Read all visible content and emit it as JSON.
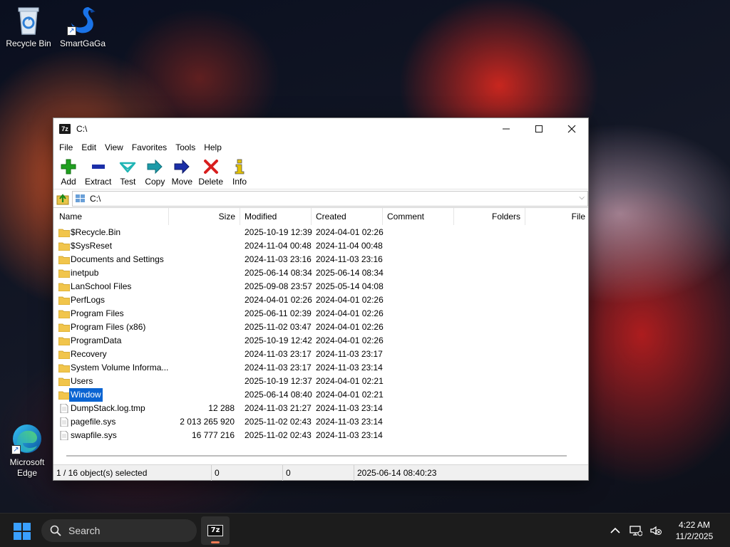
{
  "desktop": {
    "icons": [
      {
        "label": "Recycle Bin"
      },
      {
        "label": "SmartGaGa"
      },
      {
        "label": "Microsoft Edge"
      }
    ]
  },
  "window": {
    "title": "C:\\",
    "app_icon_text": "7z",
    "controls": {
      "minimize": "—",
      "maximize": "☐",
      "close": "✕"
    },
    "menu": [
      "File",
      "Edit",
      "View",
      "Favorites",
      "Tools",
      "Help"
    ],
    "toolbar": [
      {
        "label": "Add",
        "icon": "plus-icon",
        "color": "#1fa01f"
      },
      {
        "label": "Extract",
        "icon": "minus-icon",
        "color": "#1b2fa8"
      },
      {
        "label": "Test",
        "icon": "check-icon",
        "color": "#1fb5b5"
      },
      {
        "label": "Copy",
        "icon": "copy-arrow-icon",
        "color": "#1c9aa8"
      },
      {
        "label": "Move",
        "icon": "move-arrow-icon",
        "color": "#1b2fa8"
      },
      {
        "label": "Delete",
        "icon": "delete-x-icon",
        "color": "#d81e1e"
      },
      {
        "label": "Info",
        "icon": "info-icon",
        "color": "#c9a800"
      }
    ],
    "address": "C:\\",
    "columns": [
      "Name",
      "Size",
      "Modified",
      "Created",
      "Comment",
      "Folders",
      "File"
    ],
    "files": [
      {
        "name": "$Recycle.Bin",
        "size": "",
        "modified": "2025-10-19 12:39",
        "created": "2024-04-01 02:26",
        "type": "folder"
      },
      {
        "name": "$SysReset",
        "size": "",
        "modified": "2024-11-04 00:48",
        "created": "2024-11-04 00:48",
        "type": "folder"
      },
      {
        "name": "Documents and Settings",
        "size": "",
        "modified": "2024-11-03 23:16",
        "created": "2024-11-03 23:16",
        "type": "folder"
      },
      {
        "name": "inetpub",
        "size": "",
        "modified": "2025-06-14 08:34",
        "created": "2025-06-14 08:34",
        "type": "folder"
      },
      {
        "name": "LanSchool Files",
        "size": "",
        "modified": "2025-09-08 23:57",
        "created": "2025-05-14 04:08",
        "type": "folder"
      },
      {
        "name": "PerfLogs",
        "size": "",
        "modified": "2024-04-01 02:26",
        "created": "2024-04-01 02:26",
        "type": "folder"
      },
      {
        "name": "Program Files",
        "size": "",
        "modified": "2025-06-11 02:39",
        "created": "2024-04-01 02:26",
        "type": "folder"
      },
      {
        "name": "Program Files (x86)",
        "size": "",
        "modified": "2025-11-02 03:47",
        "created": "2024-04-01 02:26",
        "type": "folder"
      },
      {
        "name": "ProgramData",
        "size": "",
        "modified": "2025-10-19 12:42",
        "created": "2024-04-01 02:26",
        "type": "folder"
      },
      {
        "name": "Recovery",
        "size": "",
        "modified": "2024-11-03 23:17",
        "created": "2024-11-03 23:17",
        "type": "folder"
      },
      {
        "name": "System Volume Informa...",
        "size": "",
        "modified": "2024-11-03 23:17",
        "created": "2024-11-03 23:14",
        "type": "folder"
      },
      {
        "name": "Users",
        "size": "",
        "modified": "2025-10-19 12:37",
        "created": "2024-04-01 02:21",
        "type": "folder"
      },
      {
        "name": "Window",
        "size": "",
        "modified": "2025-06-14 08:40",
        "created": "2024-04-01 02:21",
        "type": "folder",
        "selected": true
      },
      {
        "name": "DumpStack.log.tmp",
        "size": "12 288",
        "modified": "2024-11-03 21:27",
        "created": "2024-11-03 23:14",
        "type": "file"
      },
      {
        "name": "pagefile.sys",
        "size": "2 013 265 920",
        "modified": "2025-11-02 02:43",
        "created": "2024-11-03 23:14",
        "type": "file"
      },
      {
        "name": "swapfile.sys",
        "size": "16 777 216",
        "modified": "2025-11-02 02:43",
        "created": "2024-11-03 23:14",
        "type": "file"
      }
    ],
    "status": {
      "selection": "1 / 16 object(s) selected",
      "size": "0",
      "packed": "0",
      "modified": "2025-06-14 08:40:23"
    }
  },
  "taskbar": {
    "search_label": "Search",
    "app_label": "7z",
    "time": "4:22 AM",
    "date": "11/2/2025",
    "colors": {
      "accent": "#f07a54",
      "start": "#3aa0ff"
    }
  }
}
